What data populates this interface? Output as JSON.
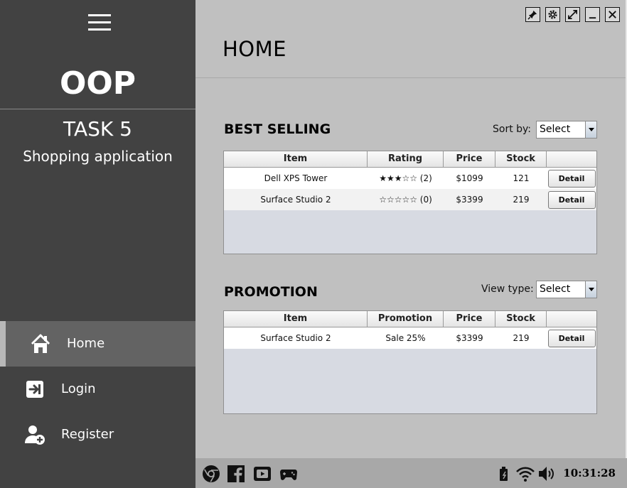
{
  "sidebar": {
    "brand": "OOP",
    "task": "TASK 5",
    "subtitle": "Shopping application",
    "nav": [
      {
        "label": "Home",
        "icon": "home-icon",
        "active": true
      },
      {
        "label": "Login",
        "icon": "login-icon",
        "active": false
      },
      {
        "label": "Register",
        "icon": "add-user-icon",
        "active": false
      }
    ]
  },
  "window_controls": [
    "pin-icon",
    "settings-icon",
    "maximize-icon",
    "minimize-icon",
    "close-icon"
  ],
  "page": {
    "title": "HOME"
  },
  "best_selling": {
    "title": "BEST SELLING",
    "sort_label": "Sort by:",
    "sort_value": "Select",
    "columns": [
      "Item",
      "Rating",
      "Price",
      "Stock"
    ],
    "rows": [
      {
        "item": "Dell XPS Tower",
        "rating": "★★★☆☆ (2)",
        "price": "$1099",
        "stock": "121",
        "action": "Detail"
      },
      {
        "item": "Surface Studio 2",
        "rating": "☆☆☆☆☆ (0)",
        "price": "$3399",
        "stock": "219",
        "action": "Detail"
      }
    ]
  },
  "promotion": {
    "title": "PROMOTION",
    "view_label": "View type:",
    "view_value": "Select",
    "columns": [
      "Item",
      "Promotion",
      "Price",
      "Stock"
    ],
    "rows": [
      {
        "item": "Surface Studio 2",
        "promotion": "Sale 25%",
        "price": "$3399",
        "stock": "219",
        "action": "Detail"
      }
    ]
  },
  "taskbar": {
    "apps": [
      "chrome-icon",
      "facebook-icon",
      "youtube-icon",
      "gamepad-icon"
    ],
    "tray": [
      "battery-icon",
      "wifi-icon",
      "volume-icon"
    ],
    "clock": "10:31:28"
  },
  "colors": {
    "sidebar_bg": "#424242",
    "active_nav_bg": "#636363",
    "main_bg": "#c0c0c0",
    "taskbar_bg": "#a8a8a8"
  }
}
